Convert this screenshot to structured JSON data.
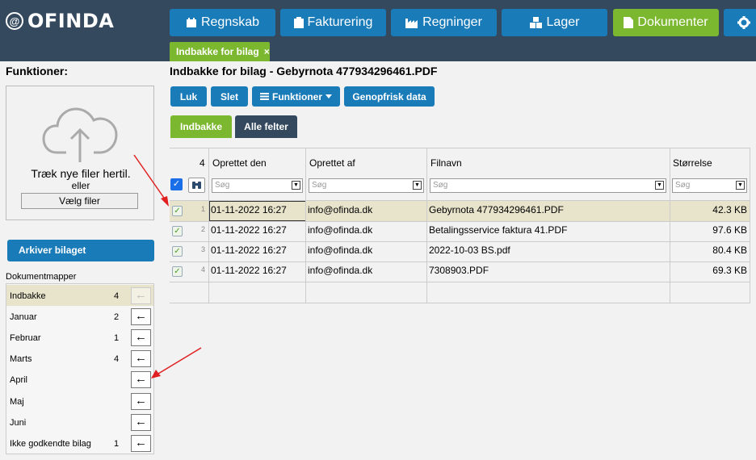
{
  "brand": {
    "logo_mark": "@",
    "name": "OFINDA"
  },
  "nav": [
    {
      "label": "Regnskab",
      "icon": "calendar-icon"
    },
    {
      "label": "Fakturering",
      "icon": "clipboard-icon"
    },
    {
      "label": "Regninger",
      "icon": "factory-icon"
    },
    {
      "label": "Lager",
      "icon": "cubes-icon"
    },
    {
      "label": "Dokumenter",
      "icon": "document-icon",
      "active": true
    },
    {
      "label": "",
      "icon": "gear-icon"
    }
  ],
  "open_tab": {
    "label": "Indbakke for bilag",
    "close": "×"
  },
  "left": {
    "heading": "Funktioner:",
    "upload": {
      "drag_text": "Træk nye filer hertil.",
      "or_text": "eller",
      "choose_label": "Vælg filer"
    },
    "archive_label": "Arkiver bilaget",
    "folders_heading": "Dokumentmapper",
    "folders": [
      {
        "name": "Indbakke",
        "count": "4",
        "arrow": "←",
        "selected": true
      },
      {
        "name": "Januar",
        "count": "2",
        "arrow": "←"
      },
      {
        "name": "Februar",
        "count": "1",
        "arrow": "←"
      },
      {
        "name": "Marts",
        "count": "4",
        "arrow": "←"
      },
      {
        "name": "April",
        "count": "",
        "arrow": "←"
      },
      {
        "name": "Maj",
        "count": "",
        "arrow": "←"
      },
      {
        "name": "Juni",
        "count": "",
        "arrow": "←"
      },
      {
        "name": "Ikke godkendte bilag",
        "count": "1",
        "arrow": "←"
      }
    ]
  },
  "main": {
    "title": "Indbakke for bilag - Gebyrnota 477934296461.PDF",
    "toolbar": {
      "luk": "Luk",
      "slet": "Slet",
      "funktioner": "Funktioner",
      "refresh": "Genopfrisk data"
    },
    "subtabs": [
      {
        "label": "Indbakke",
        "active": true
      },
      {
        "label": "Alle felter"
      }
    ],
    "grid": {
      "row_count": "4",
      "columns": [
        "Oprettet den",
        "Oprettet af",
        "Filnavn",
        "Størrelse"
      ],
      "filter_placeholder": "Søg",
      "rows": [
        {
          "n": "1",
          "created": "01-11-2022 16:27",
          "by": "info@ofinda.dk",
          "file": "Gebyrnota 477934296461.PDF",
          "size": "42.3 KB",
          "selected": true
        },
        {
          "n": "2",
          "created": "01-11-2022 16:27",
          "by": "info@ofinda.dk",
          "file": "Betalingsservice faktura 41.PDF",
          "size": "97.6 KB"
        },
        {
          "n": "3",
          "created": "01-11-2022 16:27",
          "by": "info@ofinda.dk",
          "file": "2022-10-03 BS.pdf",
          "size": "80.4 KB"
        },
        {
          "n": "4",
          "created": "01-11-2022 16:27",
          "by": "info@ofinda.dk",
          "file": "7308903.PDF",
          "size": "69.3 KB"
        }
      ]
    }
  },
  "colors": {
    "topbar": "#34495e",
    "nav_blue": "#1a7bb9",
    "active_green": "#7cb82f",
    "dark_tab": "#34495e",
    "arrow_red": "#e02020"
  }
}
